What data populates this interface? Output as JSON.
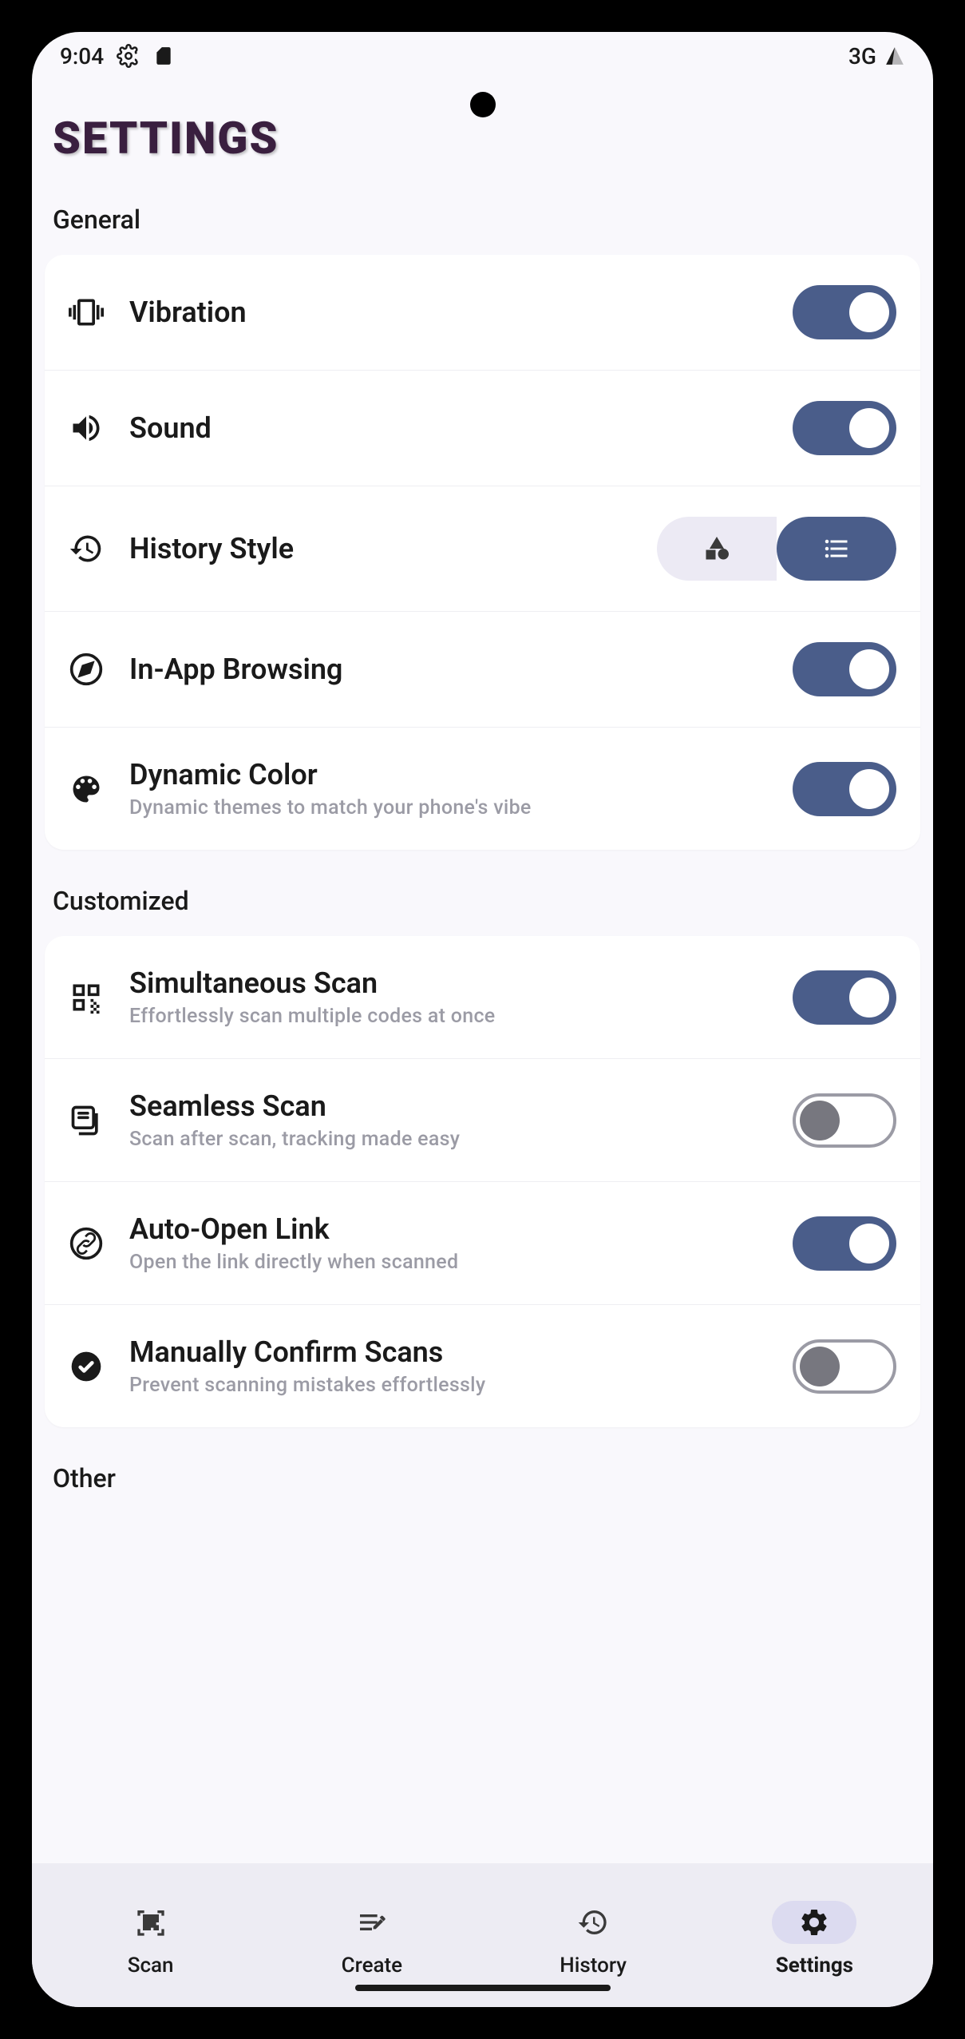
{
  "statusbar": {
    "time": "9:04",
    "network": "3G"
  },
  "page": {
    "title": "SETTINGS"
  },
  "sections": {
    "general": {
      "label": "General"
    },
    "customized": {
      "label": "Customized"
    },
    "other": {
      "label": "Other"
    }
  },
  "general": {
    "vibration": {
      "label": "Vibration",
      "on": true
    },
    "sound": {
      "label": "Sound",
      "on": true
    },
    "history_style": {
      "label": "History Style",
      "mode": "list"
    },
    "in_app_browsing": {
      "label": "In-App Browsing",
      "on": true
    },
    "dynamic_color": {
      "label": "Dynamic Color",
      "sub": "Dynamic themes to match your phone's vibe",
      "on": true
    }
  },
  "customized": {
    "simultaneous_scan": {
      "label": "Simultaneous Scan",
      "sub": "Effortlessly scan multiple codes at once",
      "on": true
    },
    "seamless_scan": {
      "label": "Seamless Scan",
      "sub": "Scan after scan, tracking made easy",
      "on": false
    },
    "auto_open_link": {
      "label": "Auto-Open Link",
      "sub": "Open the link directly when scanned",
      "on": true
    },
    "manually_confirm": {
      "label": "Manually Confirm Scans",
      "sub": "Prevent scanning mistakes effortlessly",
      "on": false
    }
  },
  "nav": {
    "scan": "Scan",
    "create": "Create",
    "history": "History",
    "settings": "Settings"
  }
}
